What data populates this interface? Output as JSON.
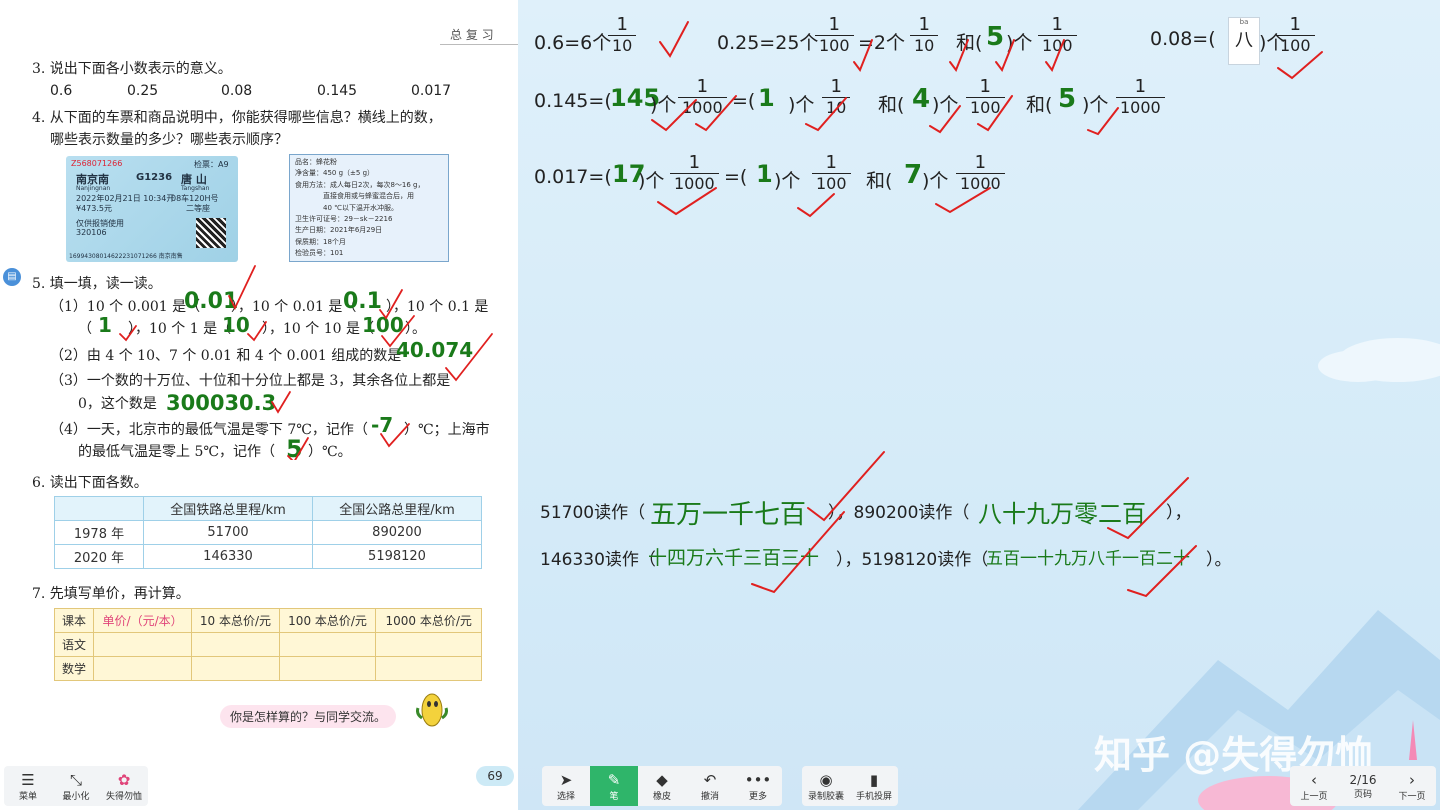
{
  "book": {
    "header": "总 复 习",
    "q3": {
      "text": "3. 说出下面各小数表示的意义。",
      "nums": [
        "0.6",
        "0.25",
        "0.08",
        "0.145",
        "0.017"
      ]
    },
    "q4": {
      "line1": "4. 从下面的车票和商品说明中，你能获得哪些信息？横线上的数，",
      "line2": "哪些表示数量的多少？哪些表示顺序？"
    },
    "ticket": {
      "code": "Z568071266",
      "gate": "检票：A9",
      "from": "南京南",
      "train": "G1236",
      "to": "唐  山",
      "from_py": "Nanjingnan",
      "to_py": "Tangshan",
      "date": "2022年02月21日 10:34开",
      "seat": "08车120H号",
      "price": "¥473.5元",
      "class": "二等座",
      "note": "仅供报销使用",
      "id": "320106",
      "serial": "16994308014622231071266 南京南售"
    },
    "label": {
      "name": "品名：蜂花粉",
      "net": "净含量：450 g（±5 g）",
      "usage1": "食用方法：成人每日2次，每次8～16 g，",
      "usage2": "直接食用或与蜂蜜混合后，用",
      "usage3": "40 ℃以下温开水冲服。",
      "license": "卫生许可证号：29－sk－2216",
      "date": "生产日期：2021年6月29日",
      "shelf": "保质期：18个月",
      "inspector": "检验员号：101"
    },
    "q5": {
      "title": "5. 填一填，读一读。",
      "l1a": "（1）10 个 0.001 是（",
      "l1b": "），10 个 0.01 是（",
      "l1c": "），10 个 0.1 是",
      "l2a": "（",
      "l2b": "），10 个 1 是（",
      "l2c": "），10 个 10 是（",
      "l2d": "）。",
      "l3": "（2）由 4 个 10、7 个 0.01 和 4 个 0.001 组成的数是",
      "l4": "（3）一个数的十万位、十位和十分位上都是 3，其余各位上都是",
      "l5": "0，这个数是",
      "l6": "（4）一天，北京市的最低气温是零下 7℃，记作（",
      "l6b": "）℃；上海市",
      "l7": "的最低气温是零上 5℃，记作（",
      "l7b": "）℃。",
      "ans": [
        "0.01",
        "0.1",
        "1",
        "10",
        "100",
        "40.074",
        "300030.3",
        "-7",
        "5"
      ]
    },
    "q6": {
      "title": "6. 读出下面各数。",
      "headers": [
        "",
        "全国铁路总里程/km",
        "全国公路总里程/km"
      ],
      "rows": [
        [
          "1978 年",
          "51700",
          "890200"
        ],
        [
          "2020 年",
          "146330",
          "5198120"
        ]
      ]
    },
    "q7": {
      "title": "7. 先填写单价，再计算。",
      "headers": [
        "课本",
        "单价/（元/本）",
        "10 本总价/元",
        "100 本总价/元",
        "1000 本总价/元"
      ],
      "rows": [
        [
          "语文",
          "",
          "",
          "",
          ""
        ],
        [
          "数学",
          "",
          "",
          "",
          ""
        ]
      ]
    },
    "bubble": "你是怎样算的？与同学交流。",
    "page": "69"
  },
  "board": {
    "row1": [
      {
        "pre": "0.6=6个",
        "num": "1",
        "den": "10"
      },
      {
        "pre": "0.25=25个",
        "num": "1",
        "den": "100"
      },
      {
        "mid": "=2个",
        "num": "1",
        "den": "10"
      },
      {
        "mid2": "和(",
        "ans": "5",
        "post": ")个",
        "num": "1",
        "den": "100"
      },
      {
        "pre": "0.08=(",
        "ans": "八",
        "post": ")个",
        "num": "1",
        "den": "100"
      }
    ],
    "row2": {
      "pre": "0.145=(",
      "a1": "145",
      "t1": ")个",
      "n1": "1",
      "d1": "1000",
      "t2": "=(",
      "a2": "1",
      "t3": ")个",
      "n2": "1",
      "d2": "10",
      "t4": "和(",
      "a3": "4",
      "t5": ")个",
      "n3": "1",
      "d3": "100",
      "t6": "和(",
      "a4": "5",
      "t7": ")个",
      "n4": "1",
      "d4": "1000"
    },
    "row3": {
      "pre": "0.017=(",
      "a1": "17",
      "t1": ")个",
      "n1": "1",
      "d1": "1000",
      "t2": "=(",
      "a2": "1",
      "t3": ")个",
      "n2": "1",
      "d2": "100",
      "t4": "和(",
      "a3": "7",
      "t5": ")个",
      "n3": "1",
      "d3": "1000"
    },
    "read1": {
      "a": "51700读作（",
      "ans_a": "五万一千七百",
      "b": "），890200读作（",
      "ans_b": "八十九万零二百",
      "c": "），"
    },
    "read2": {
      "a": "146330读作（",
      "ans_a": "十四万六千三百三十",
      "b": "），5198120读作（",
      "ans_b": "五百一十九万八千一百二十",
      "c": "）。"
    },
    "ime": {
      "top": "ba",
      "char": "八"
    },
    "watermark": "知乎 @失得勿恤"
  },
  "toolbar_left": [
    {
      "icon": "menu-icon",
      "glyph": "☰",
      "label": "菜单"
    },
    {
      "icon": "minimize-icon",
      "glyph": "⤡",
      "label": "最小化"
    },
    {
      "icon": "avatar-icon",
      "glyph": "✿",
      "label": "失得勿恤"
    }
  ],
  "toolbar_main": [
    {
      "icon": "cursor-icon",
      "glyph": "➤",
      "label": "选择"
    },
    {
      "icon": "pen-icon",
      "glyph": "✎",
      "label": "笔",
      "active": true
    },
    {
      "icon": "eraser-icon",
      "glyph": "◆",
      "label": "橡皮"
    },
    {
      "icon": "undo-icon",
      "glyph": "↶",
      "label": "撤消"
    },
    {
      "icon": "more-icon",
      "glyph": "•••",
      "label": "更多"
    }
  ],
  "toolbar_record": [
    {
      "icon": "record-icon",
      "glyph": "◉",
      "label": "录制胶囊"
    },
    {
      "icon": "phone-icon",
      "glyph": "▮",
      "label": "手机投屏"
    }
  ],
  "pager": {
    "prev": "上一页",
    "page": "2/16",
    "page_label": "页码",
    "next": "下一页"
  },
  "colors": {
    "ink": "#1a7a1a",
    "check": "#e0201f",
    "active": "#2fb56a"
  }
}
